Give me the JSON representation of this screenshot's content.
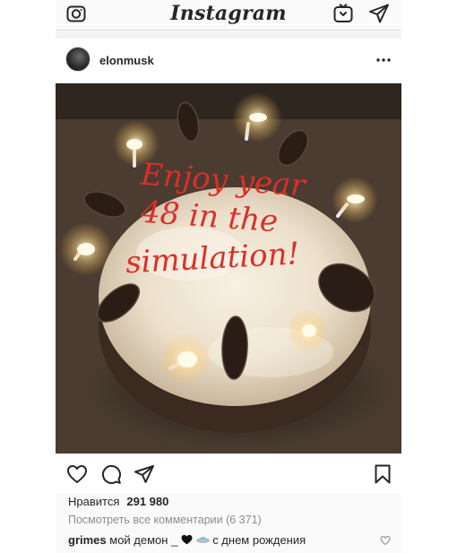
{
  "header": {
    "app_title": "Instagram",
    "icons": [
      "camera-icon",
      "igtv-icon",
      "direct-message-icon"
    ]
  },
  "post": {
    "username": "elonmusk",
    "more_icon": "more-options-icon",
    "photo_text": [
      "Enjoy year",
      "48 in the",
      "simulation!"
    ],
    "likes_label": "Нравится",
    "likes_count": "291 980",
    "view_comments": "Посмотреть все комментарии (6 371)",
    "caption": {
      "username": "grimes",
      "text_before": "мой демон _",
      "text_after": "с днем рождения",
      "emojis": [
        "black-heart-icon",
        "flying-saucer-icon"
      ]
    }
  },
  "actions": {
    "icons": [
      "heart-icon",
      "comment-icon",
      "share-icon",
      "bookmark-icon"
    ]
  },
  "colors": {
    "icing_text": "#d9302a",
    "background": "#fafafa",
    "muted_text": "#8e8e8e"
  }
}
